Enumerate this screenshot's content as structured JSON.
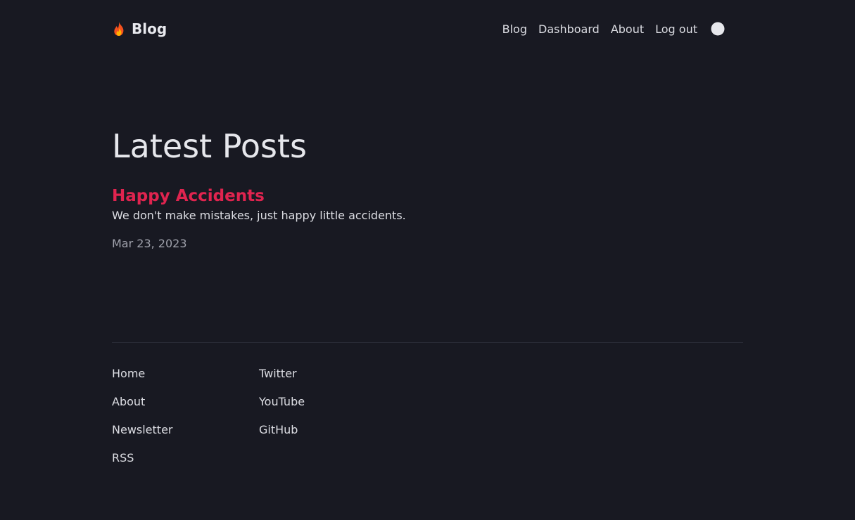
{
  "header": {
    "brand_label": "Blog",
    "nav": [
      {
        "label": "Blog"
      },
      {
        "label": "Dashboard"
      },
      {
        "label": "About"
      },
      {
        "label": "Log out"
      }
    ]
  },
  "main": {
    "heading": "Latest Posts",
    "posts": [
      {
        "title": "Happy Accidents",
        "excerpt": "We don't make mistakes, just happy little accidents.",
        "date": "Mar 23, 2023"
      }
    ]
  },
  "footer": {
    "col1": [
      {
        "label": "Home"
      },
      {
        "label": "About"
      },
      {
        "label": "Newsletter"
      },
      {
        "label": "RSS"
      }
    ],
    "col2": [
      {
        "label": "Twitter"
      },
      {
        "label": "YouTube"
      },
      {
        "label": "GitHub"
      }
    ]
  },
  "colors": {
    "background": "#181922",
    "accent": "#e0244f",
    "text": "#dcdde3",
    "muted": "#9fa1ab"
  },
  "icons": {
    "brand": "fire-icon",
    "theme_toggle": "moon-icon"
  }
}
